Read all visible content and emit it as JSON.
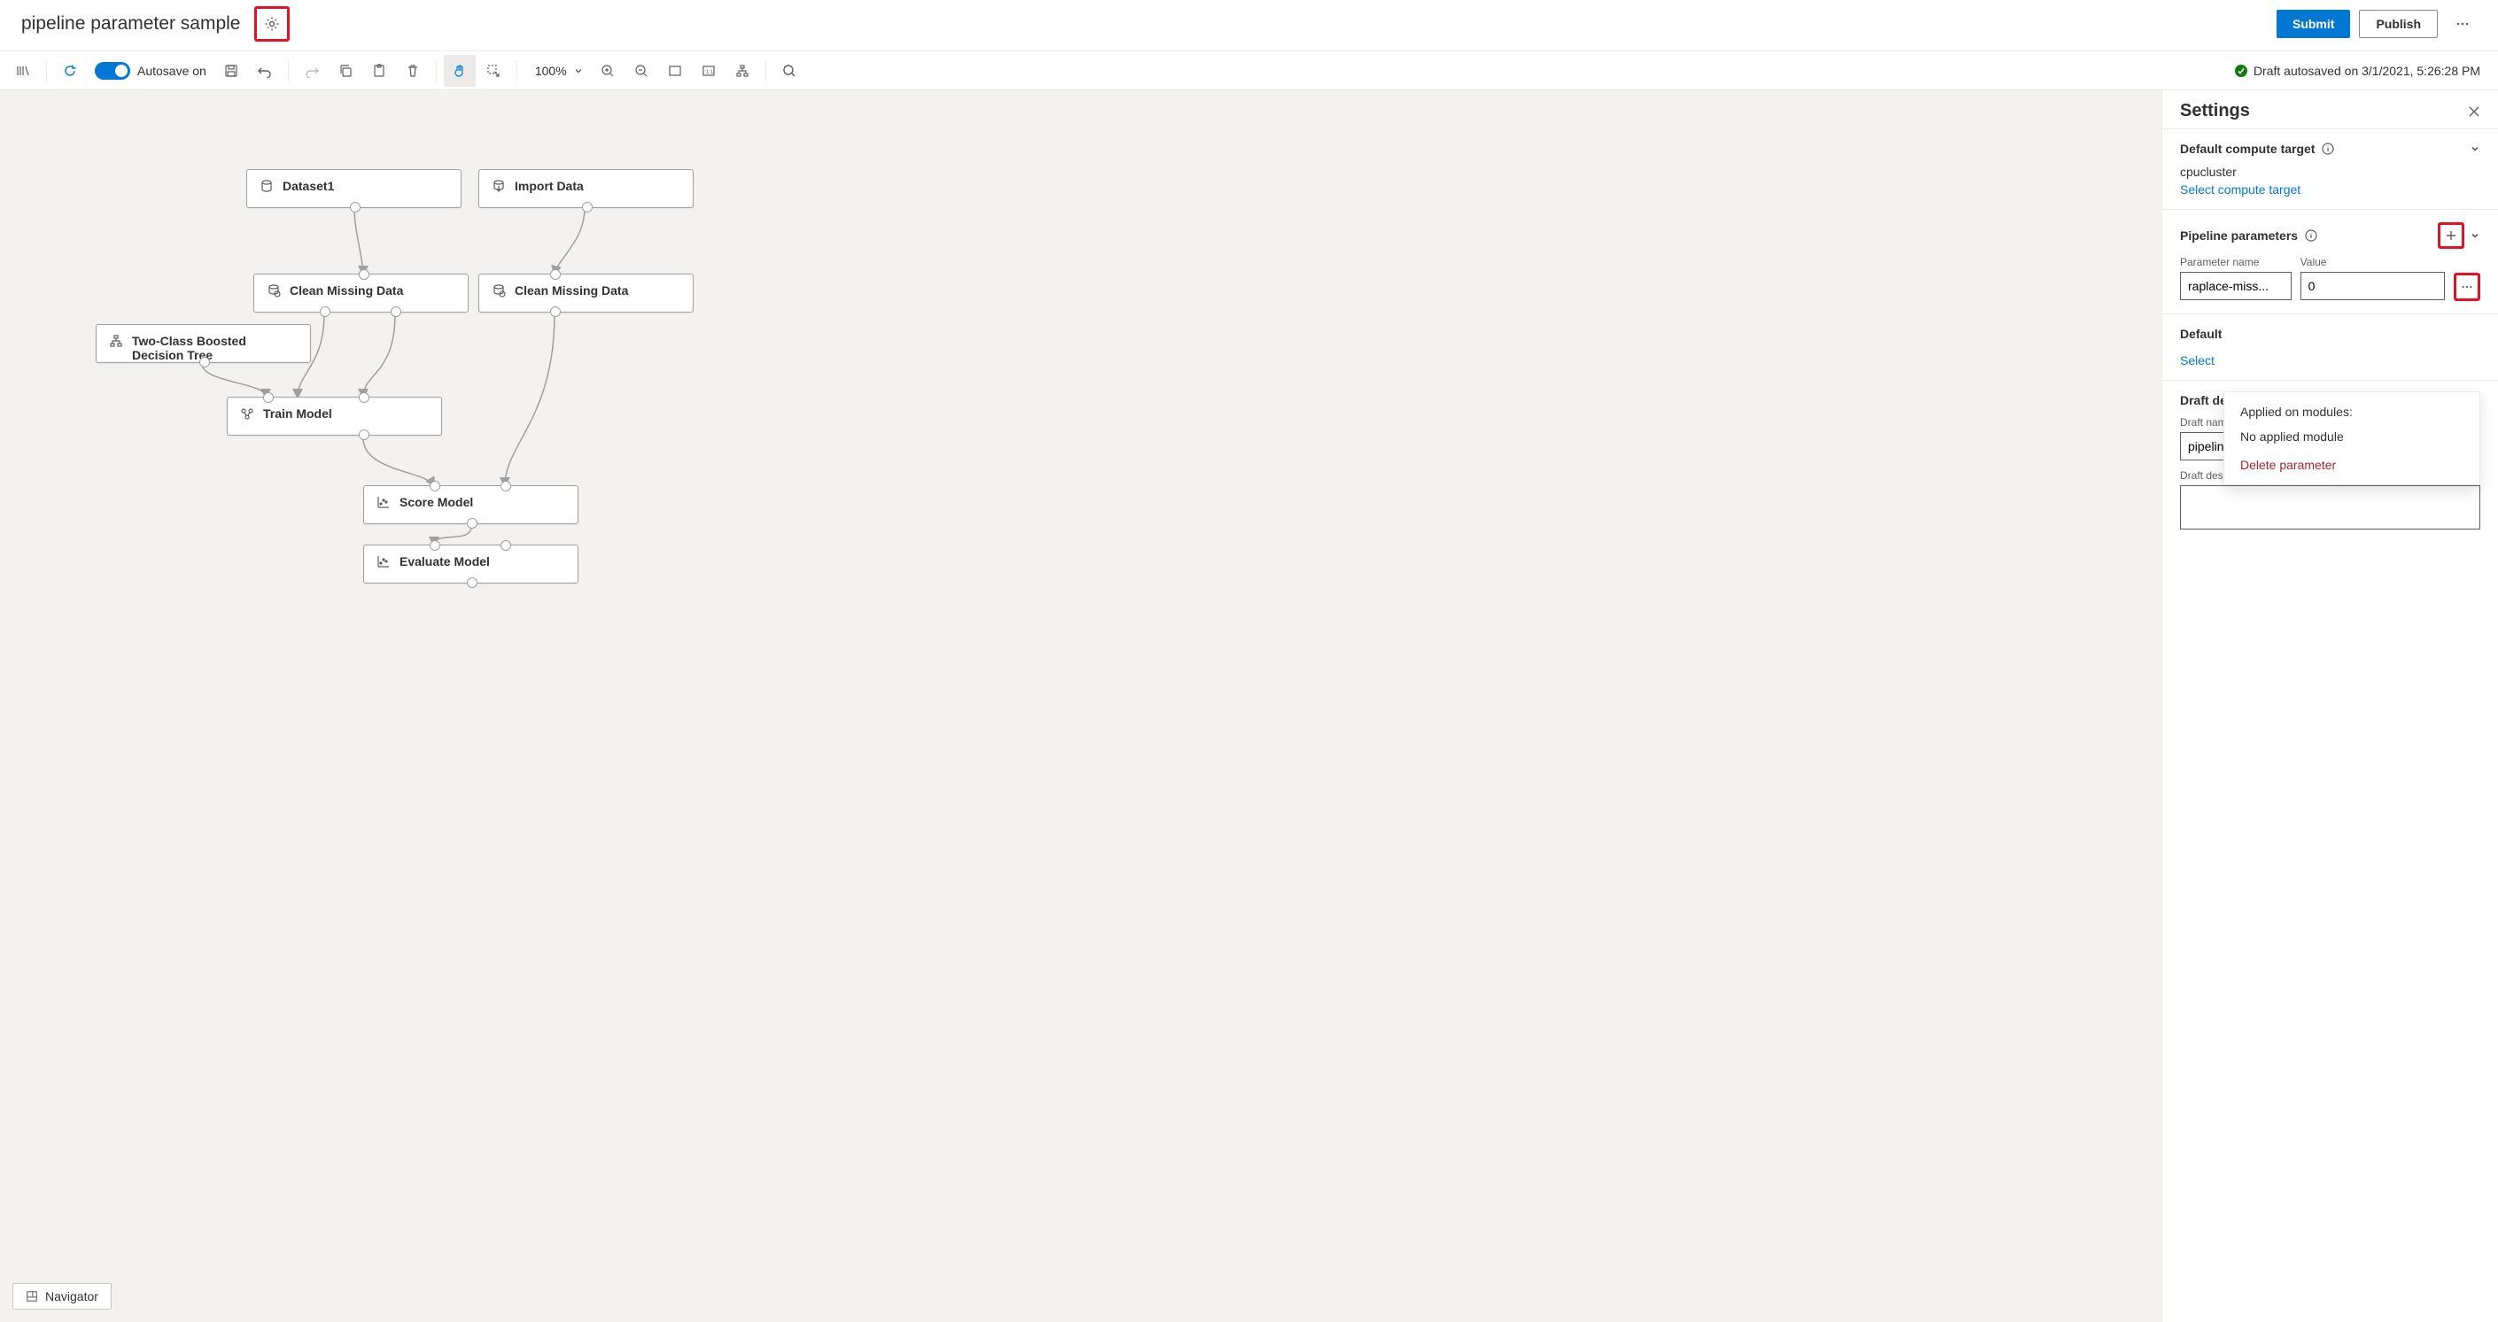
{
  "header": {
    "title": "pipeline parameter sample",
    "submit_label": "Submit",
    "publish_label": "Publish"
  },
  "toolbar": {
    "autosave_label": "Autosave on",
    "zoom_label": "100%",
    "status_text": "Draft autosaved on 3/1/2021, 5:26:28 PM"
  },
  "canvas": {
    "nodes": {
      "dataset1": "Dataset1",
      "import_data": "Import Data",
      "clean1": "Clean Missing Data",
      "clean2": "Clean Missing Data",
      "two_class": "Two-Class Boosted Decision Tree",
      "train": "Train Model",
      "score": "Score Model",
      "evaluate": "Evaluate Model"
    },
    "navigator_label": "Navigator"
  },
  "settings": {
    "title": "Settings",
    "compute": {
      "section_title": "Default compute target",
      "value": "cpucluster",
      "link": "Select compute target"
    },
    "parameters": {
      "section_title": "Pipeline parameters",
      "name_label": "Parameter name",
      "value_label": "Value",
      "param_name": "raplace-miss...",
      "param_value": "0"
    },
    "popover": {
      "applied_title": "Applied on modules:",
      "applied_text": "No applied module",
      "delete_label": "Delete parameter"
    },
    "datastore": {
      "section_title_prefix": "Default",
      "link_prefix": "Select "
    },
    "draft": {
      "section_title": "Draft details",
      "name_label": "Draft name",
      "name_value": "pipeline parameter sample",
      "desc_label": "Draft description (optional)"
    }
  }
}
